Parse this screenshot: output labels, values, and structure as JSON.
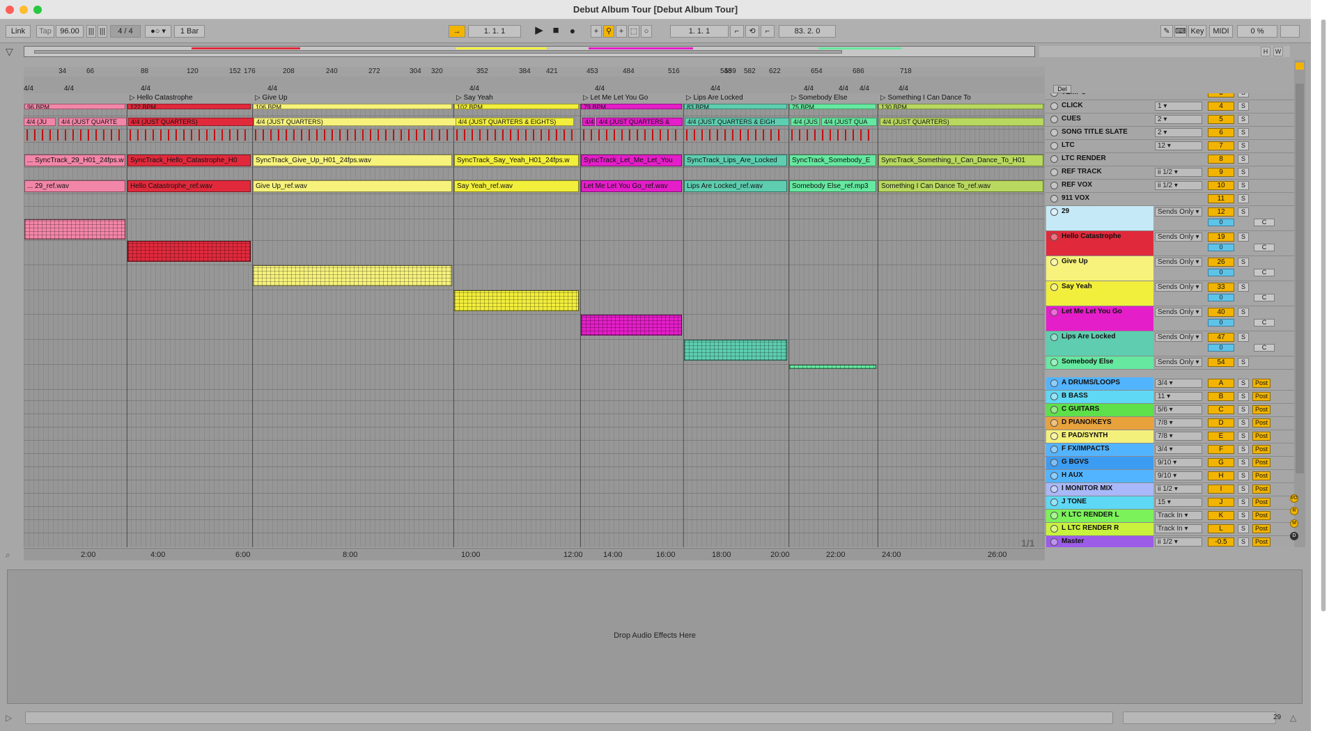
{
  "window": {
    "title": "Debut Album Tour  [Debut Album Tour]"
  },
  "transport": {
    "link": "Link",
    "tap": "Tap",
    "tempo": "96.00",
    "meter": "4 / 4",
    "quantize": "1 Bar",
    "position": "1.   1.   1",
    "loop_start": "1.   1.   1",
    "loop_length": "83.   2.   0",
    "key": "Key",
    "midi": "MIDI",
    "cpu": "0 %"
  },
  "bar_ruler": [
    "34",
    "66",
    "88",
    "120",
    "152",
    "176",
    "208",
    "240",
    "272",
    "304",
    "320",
    "352",
    "384",
    "421",
    "453",
    "484",
    "516",
    "548",
    "559",
    "582",
    "622",
    "654",
    "686",
    "718"
  ],
  "locators": [
    "Hello Catastrophe",
    "Give Up",
    "Say Yeah",
    "Let Me Let You Go",
    "Lips Are Locked",
    "Somebody Else",
    "Something I Can Dance To"
  ],
  "time_ruler": [
    "2:00",
    "4:00",
    "6:00",
    "8:00",
    "10:00",
    "12:00",
    "14:00",
    "16:00",
    "18:00",
    "20:00",
    "22:00",
    "24:00",
    "26:00"
  ],
  "clips": {
    "tempo_row": [
      "96 BPM",
      "122 BPM",
      "106 BPM",
      "102 BPM",
      "79 BPM",
      "83 BPM",
      "75 BPM",
      "130 BPM"
    ],
    "click_row": [
      "4/4 (JU",
      "4/4 (JUST QUARTE",
      "4/4 (JUST QUARTERS)",
      "4/4 (JUST QUARTERS)",
      "4/4 (JUST QUARTERS & EIGHTS)",
      "4/4",
      "4/4 (JUST QUARTERS &",
      "4/4 (JUST QUARTERS & EIGH",
      "4/4 (JUS",
      "4/4 (JUST QUA",
      "4/4 (JUST QUARTERS)"
    ],
    "ltc_row": [
      "... SyncTrack_29_H01_24fps.w",
      "SyncTrack_Hello_Catastrophe_H0",
      "SyncTrack_Give_Up_H01_24fps.wav",
      "SyncTrack_Say_Yeah_H01_24fps.w",
      "SyncTrack_Let_Me_Let_You",
      "SyncTrack_Lips_Are_Locked",
      "SyncTrack_Somebody_E",
      "SyncTrack_Something_I_Can_Dance_To_H01"
    ],
    "ref_row": [
      "... 29_ref.wav",
      "Hello Catastrophe_ref.wav",
      "Give Up_ref.wav",
      "Say Yeah_ref.wav",
      "Let Me Let You Go_ref.wav",
      "Lips Are Locked_ref.wav",
      "Somebody Else_ref.mp3",
      "Something I Can Dance To_ref.wav"
    ]
  },
  "tracks": [
    {
      "name": "TEMPO",
      "io": "",
      "num": "3",
      "color": "#a6a6a6"
    },
    {
      "name": "CLICK",
      "io": "1",
      "num": "4",
      "color": "#a6a6a6"
    },
    {
      "name": "CUES",
      "io": "2",
      "num": "5",
      "color": "#a6a6a6"
    },
    {
      "name": "SONG TITLE SLATE",
      "io": "2",
      "num": "6",
      "color": "#a6a6a6"
    },
    {
      "name": "LTC",
      "io": "12",
      "num": "7",
      "color": "#a6a6a6"
    },
    {
      "name": "LTC RENDER",
      "io": "",
      "num": "8",
      "color": "#a6a6a6"
    },
    {
      "name": "REF TRACK",
      "io": "ii 1/2",
      "num": "9",
      "color": "#a6a6a6"
    },
    {
      "name": "REF VOX",
      "io": "ii 1/2",
      "num": "10",
      "color": "#a6a6a6"
    },
    {
      "name": "911 VOX",
      "io": "",
      "num": "11",
      "color": "#a6a6a6"
    },
    {
      "name": "29",
      "io": "Sends Only",
      "num": "12",
      "color": "#c6e9f7",
      "pan": "0",
      "c": "C"
    },
    {
      "name": "Hello Catastrophe",
      "io": "Sends Only",
      "num": "19",
      "color": "#e02a3c",
      "pan": "0",
      "c": "C"
    },
    {
      "name": "Give Up",
      "io": "Sends Only",
      "num": "26",
      "color": "#f6f27c",
      "pan": "0",
      "c": "C"
    },
    {
      "name": "Say Yeah",
      "io": "Sends Only",
      "num": "33",
      "color": "#f2ee3c",
      "pan": "0",
      "c": "C"
    },
    {
      "name": "Let Me Let You Go",
      "io": "Sends Only",
      "num": "40",
      "color": "#e41ec8",
      "pan": "0",
      "c": "C"
    },
    {
      "name": "Lips Are Locked",
      "io": "Sends Only",
      "num": "47",
      "color": "#5ecdb0",
      "pan": "0",
      "c": "C"
    },
    {
      "name": "Somebody Else",
      "io": "Sends Only",
      "num": "54",
      "color": "#66e8a0"
    }
  ],
  "returns": [
    {
      "name": "A DRUMS/LOOPS",
      "io": "3/4",
      "num": "A",
      "color": "#52b4ff"
    },
    {
      "name": "B BASS",
      "io": "11",
      "num": "B",
      "color": "#5ed8f4"
    },
    {
      "name": "C GUITARS",
      "io": "5/6",
      "num": "C",
      "color": "#5ee04a"
    },
    {
      "name": "D PIANO/KEYS",
      "io": "7/8",
      "num": "D",
      "color": "#e8a23c"
    },
    {
      "name": "E PAD/SYNTH",
      "io": "7/8",
      "num": "E",
      "color": "#f4f07c"
    },
    {
      "name": "F FX/IMPACTS",
      "io": "3/4",
      "num": "F",
      "color": "#52b4ff"
    },
    {
      "name": "G BGVS",
      "io": "9/10",
      "num": "G",
      "color": "#3c9cf2"
    },
    {
      "name": "H AUX",
      "io": "9/10",
      "num": "H",
      "color": "#52b4ff"
    },
    {
      "name": "I MONITOR MIX",
      "io": "ii 1/2",
      "num": "I",
      "color": "#a8b8f8"
    },
    {
      "name": "J TONE",
      "io": "15",
      "num": "J",
      "color": "#5ed8f4"
    },
    {
      "name": "K LTC RENDER L",
      "io": "Track In",
      "num": "K",
      "color": "#7cf25a"
    },
    {
      "name": "L LTC RENDER R",
      "io": "Track In",
      "num": "L",
      "color": "#c8f23c"
    },
    {
      "name": "Master",
      "io": "ii 1/2",
      "num": "-0.5",
      "color": "#9c5ce8"
    }
  ],
  "post_label": "Post",
  "solo_label": "S",
  "page_counter": "1/1",
  "detail": {
    "drop_text": "Drop Audio Effects Here"
  },
  "status": {
    "right_number": "29"
  },
  "sig_labels": [
    "4/4",
    "4/4",
    "4/4",
    "4/4",
    "4/4",
    "4/4",
    "4/4",
    "4/4",
    "4/4",
    "4/4",
    "4/4"
  ],
  "del_label": "Del"
}
